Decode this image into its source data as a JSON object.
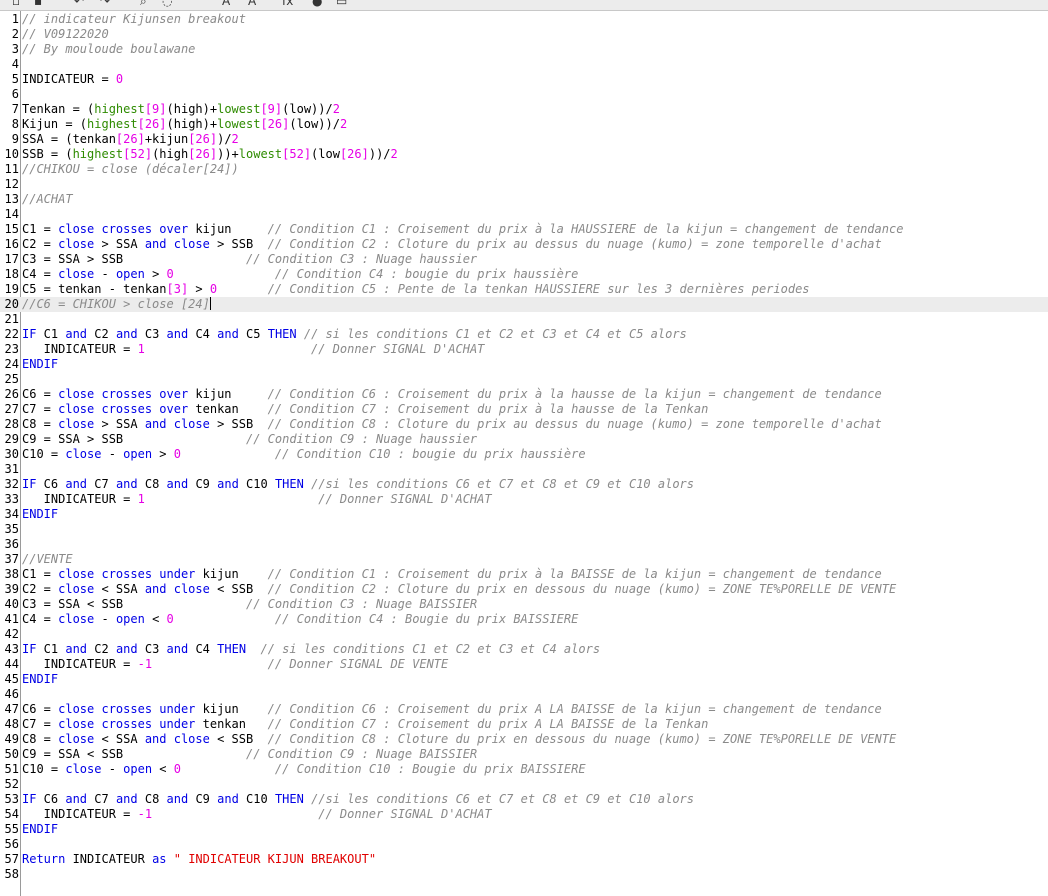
{
  "toolbar": {
    "buttons": [
      {
        "name": "new-file-icon",
        "glyph": "▫"
      },
      {
        "name": "open-folder-icon",
        "glyph": "▪"
      },
      {
        "name": "undo-icon",
        "glyph": "↶"
      },
      {
        "name": "redo-icon",
        "glyph": "↷"
      },
      {
        "name": "search-icon",
        "glyph": "⌕"
      },
      {
        "name": "comment-icon",
        "glyph": "◌"
      },
      {
        "name": "font-increase-icon",
        "glyph": "A"
      },
      {
        "name": "font-decrease-icon",
        "glyph": "A"
      },
      {
        "name": "function-icon",
        "glyph": "fx"
      },
      {
        "name": "help-icon",
        "glyph": "●"
      },
      {
        "name": "print-icon",
        "glyph": "▭"
      }
    ]
  },
  "editor": {
    "current_line": 20,
    "colors": {
      "keyword": "#0000e6",
      "number": "#e600e6",
      "function": "#2e8b00",
      "comment": "#8a8a8a",
      "string": "#e00000"
    },
    "lines": [
      {
        "n": "1",
        "t": [
          [
            "c",
            "// indicateur Kijunsen breakout"
          ]
        ]
      },
      {
        "n": "2",
        "t": [
          [
            "c",
            "// V09122020"
          ]
        ]
      },
      {
        "n": "3",
        "t": [
          [
            "c",
            "// By mouloude boulawane"
          ]
        ]
      },
      {
        "n": "4",
        "t": []
      },
      {
        "n": "5",
        "t": [
          [
            "p",
            "INDICATEUR = "
          ],
          [
            "n",
            "0"
          ]
        ]
      },
      {
        "n": "6",
        "t": []
      },
      {
        "n": "7",
        "t": [
          [
            "p",
            "Tenkan = ("
          ],
          [
            "f",
            "highest"
          ],
          [
            "n",
            "[9]"
          ],
          [
            "p",
            "(high)+"
          ],
          [
            "f",
            "lowest"
          ],
          [
            "n",
            "[9]"
          ],
          [
            "p",
            "(low))/"
          ],
          [
            "n",
            "2"
          ]
        ]
      },
      {
        "n": "8",
        "t": [
          [
            "p",
            "Kijun = ("
          ],
          [
            "f",
            "highest"
          ],
          [
            "n",
            "[26]"
          ],
          [
            "p",
            "(high)+"
          ],
          [
            "f",
            "lowest"
          ],
          [
            "n",
            "[26]"
          ],
          [
            "p",
            "(low))/"
          ],
          [
            "n",
            "2"
          ]
        ]
      },
      {
        "n": "9",
        "t": [
          [
            "p",
            "SSA = (tenkan"
          ],
          [
            "n",
            "[26]"
          ],
          [
            "p",
            "+kijun"
          ],
          [
            "n",
            "[26]"
          ],
          [
            "p",
            ")/"
          ],
          [
            "n",
            "2"
          ]
        ]
      },
      {
        "n": "10",
        "t": [
          [
            "p",
            "SSB = ("
          ],
          [
            "f",
            "highest"
          ],
          [
            "n",
            "[52]"
          ],
          [
            "p",
            "(high"
          ],
          [
            "n",
            "[26]"
          ],
          [
            "p",
            "))+"
          ],
          [
            "f",
            "lowest"
          ],
          [
            "n",
            "[52]"
          ],
          [
            "p",
            "(low"
          ],
          [
            "n",
            "[26]"
          ],
          [
            "p",
            "))/"
          ],
          [
            "n",
            "2"
          ]
        ]
      },
      {
        "n": "11",
        "t": [
          [
            "c",
            "//CHIKOU = close (décaler[24])"
          ]
        ]
      },
      {
        "n": "12",
        "t": []
      },
      {
        "n": "13",
        "t": [
          [
            "c",
            "//ACHAT"
          ]
        ]
      },
      {
        "n": "14",
        "t": []
      },
      {
        "n": "15",
        "t": [
          [
            "p",
            "C1 = "
          ],
          [
            "k",
            "close crosses over"
          ],
          [
            "p",
            " kijun     "
          ],
          [
            "c",
            "// Condition C1 : Croisement du prix à la HAUSSIERE de la kijun = changement de tendance"
          ]
        ]
      },
      {
        "n": "16",
        "t": [
          [
            "p",
            "C2 = "
          ],
          [
            "k",
            "close"
          ],
          [
            "p",
            " > SSA "
          ],
          [
            "k",
            "and close"
          ],
          [
            "p",
            " > SSB  "
          ],
          [
            "c",
            "// Condition C2 : Cloture du prix au dessus du nuage (kumo) = zone temporelle d'achat"
          ]
        ]
      },
      {
        "n": "17",
        "t": [
          [
            "p",
            "C3 = SSA > SSB                 "
          ],
          [
            "c",
            "// Condition C3 : Nuage haussier"
          ]
        ]
      },
      {
        "n": "18",
        "t": [
          [
            "p",
            "C4 = "
          ],
          [
            "k",
            "close"
          ],
          [
            "p",
            " - "
          ],
          [
            "k",
            "open"
          ],
          [
            "p",
            " > "
          ],
          [
            "n",
            "0"
          ],
          [
            "p",
            "              "
          ],
          [
            "c",
            "// Condition C4 : bougie du prix haussière"
          ]
        ]
      },
      {
        "n": "19",
        "t": [
          [
            "p",
            "C5 = tenkan - tenkan"
          ],
          [
            "n",
            "[3]"
          ],
          [
            "p",
            " > "
          ],
          [
            "n",
            "0"
          ],
          [
            "p",
            "       "
          ],
          [
            "c",
            "// Condition C5 : Pente de la tenkan HAUSSIERE sur les 3 dernières periodes"
          ]
        ]
      },
      {
        "n": "20",
        "t": [
          [
            "c",
            "//C6 = CHIKOU > close [24]"
          ]
        ]
      },
      {
        "n": "21",
        "t": []
      },
      {
        "n": "22",
        "t": [
          [
            "k",
            "IF"
          ],
          [
            "p",
            " C1 "
          ],
          [
            "k",
            "and"
          ],
          [
            "p",
            " C2 "
          ],
          [
            "k",
            "and"
          ],
          [
            "p",
            " C3 "
          ],
          [
            "k",
            "and"
          ],
          [
            "p",
            " C4 "
          ],
          [
            "k",
            "and"
          ],
          [
            "p",
            " C5 "
          ],
          [
            "k",
            "THEN"
          ],
          [
            "p",
            " "
          ],
          [
            "c",
            "// si les conditions C1 et C2 et C3 et C4 et C5 alors"
          ]
        ]
      },
      {
        "n": "23",
        "t": [
          [
            "p",
            "   INDICATEUR = "
          ],
          [
            "n",
            "1"
          ],
          [
            "p",
            "                       "
          ],
          [
            "c",
            "// Donner SIGNAL D'ACHAT"
          ]
        ]
      },
      {
        "n": "24",
        "t": [
          [
            "k",
            "ENDIF"
          ]
        ]
      },
      {
        "n": "25",
        "t": []
      },
      {
        "n": "26",
        "t": [
          [
            "p",
            "C6 = "
          ],
          [
            "k",
            "close crosses over"
          ],
          [
            "p",
            " kijun     "
          ],
          [
            "c",
            "// Condition C6 : Croisement du prix à la hausse de la kijun = changement de tendance"
          ]
        ]
      },
      {
        "n": "27",
        "t": [
          [
            "p",
            "C7 = "
          ],
          [
            "k",
            "close crosses over"
          ],
          [
            "p",
            " tenkan    "
          ],
          [
            "c",
            "// Condition C7 : Croisement du prix à la hausse de la Tenkan"
          ]
        ]
      },
      {
        "n": "28",
        "t": [
          [
            "p",
            "C8 = "
          ],
          [
            "k",
            "close"
          ],
          [
            "p",
            " > SSA "
          ],
          [
            "k",
            "and close"
          ],
          [
            "p",
            " > SSB  "
          ],
          [
            "c",
            "// Condition C8 : Cloture du prix au dessus du nuage (kumo) = zone temporelle d'achat"
          ]
        ]
      },
      {
        "n": "29",
        "t": [
          [
            "p",
            "C9 = SSA > SSB                 "
          ],
          [
            "c",
            "// Condition C9 : Nuage haussier"
          ]
        ]
      },
      {
        "n": "30",
        "t": [
          [
            "p",
            "C10 = "
          ],
          [
            "k",
            "close"
          ],
          [
            "p",
            " - "
          ],
          [
            "k",
            "open"
          ],
          [
            "p",
            " > "
          ],
          [
            "n",
            "0"
          ],
          [
            "p",
            "             "
          ],
          [
            "c",
            "// Condition C10 : bougie du prix haussière"
          ]
        ]
      },
      {
        "n": "31",
        "t": []
      },
      {
        "n": "32",
        "t": [
          [
            "k",
            "IF"
          ],
          [
            "p",
            " C6 "
          ],
          [
            "k",
            "and"
          ],
          [
            "p",
            " C7 "
          ],
          [
            "k",
            "and"
          ],
          [
            "p",
            " C8 "
          ],
          [
            "k",
            "and"
          ],
          [
            "p",
            " C9 "
          ],
          [
            "k",
            "and"
          ],
          [
            "p",
            " C10 "
          ],
          [
            "k",
            "THEN"
          ],
          [
            "p",
            " "
          ],
          [
            "c",
            "//si les conditions C6 et C7 et C8 et C9 et C10 alors"
          ]
        ]
      },
      {
        "n": "33",
        "t": [
          [
            "p",
            "   INDICATEUR = "
          ],
          [
            "n",
            "1"
          ],
          [
            "p",
            "                        "
          ],
          [
            "c",
            "// Donner SIGNAL D'ACHAT"
          ]
        ]
      },
      {
        "n": "34",
        "t": [
          [
            "k",
            "ENDIF"
          ]
        ]
      },
      {
        "n": "35",
        "t": []
      },
      {
        "n": "36",
        "t": []
      },
      {
        "n": "37",
        "t": [
          [
            "c",
            "//VENTE"
          ]
        ]
      },
      {
        "n": "38",
        "t": [
          [
            "p",
            "C1 = "
          ],
          [
            "k",
            "close crosses under"
          ],
          [
            "p",
            " kijun    "
          ],
          [
            "c",
            "// Condition C1 : Croisement du prix à la BAISSE de la kijun = changement de tendance"
          ]
        ]
      },
      {
        "n": "39",
        "t": [
          [
            "p",
            "C2 = "
          ],
          [
            "k",
            "close"
          ],
          [
            "p",
            " < SSA "
          ],
          [
            "k",
            "and close"
          ],
          [
            "p",
            " < SSB  "
          ],
          [
            "c",
            "// Condition C2 : Cloture du prix en dessous du nuage (kumo) = ZONE TE%PORELLE DE VENTE"
          ]
        ]
      },
      {
        "n": "40",
        "t": [
          [
            "p",
            "C3 = SSA < SSB                 "
          ],
          [
            "c",
            "// Condition C3 : Nuage BAISSIER"
          ]
        ]
      },
      {
        "n": "41",
        "t": [
          [
            "p",
            "C4 = "
          ],
          [
            "k",
            "close"
          ],
          [
            "p",
            " - "
          ],
          [
            "k",
            "open"
          ],
          [
            "p",
            " < "
          ],
          [
            "n",
            "0"
          ],
          [
            "p",
            "              "
          ],
          [
            "c",
            "// Condition C4 : Bougie du prix BAISSIERE"
          ]
        ]
      },
      {
        "n": "42",
        "t": []
      },
      {
        "n": "43",
        "t": [
          [
            "k",
            "IF"
          ],
          [
            "p",
            " C1 "
          ],
          [
            "k",
            "and"
          ],
          [
            "p",
            " C2 "
          ],
          [
            "k",
            "and"
          ],
          [
            "p",
            " C3 "
          ],
          [
            "k",
            "and"
          ],
          [
            "p",
            " C4 "
          ],
          [
            "k",
            "THEN"
          ],
          [
            "p",
            "  "
          ],
          [
            "c",
            "// si les conditions C1 et C2 et C3 et C4 alors"
          ]
        ]
      },
      {
        "n": "44",
        "t": [
          [
            "p",
            "   INDICATEUR = "
          ],
          [
            "n",
            "-1"
          ],
          [
            "p",
            "                "
          ],
          [
            "c",
            "// Donner SIGNAL DE VENTE"
          ]
        ]
      },
      {
        "n": "45",
        "t": [
          [
            "k",
            "ENDIF"
          ]
        ]
      },
      {
        "n": "46",
        "t": []
      },
      {
        "n": "47",
        "t": [
          [
            "p",
            "C6 = "
          ],
          [
            "k",
            "close crosses under"
          ],
          [
            "p",
            " kijun    "
          ],
          [
            "c",
            "// Condition C6 : Croisement du prix A LA BAISSE de la kijun = changement de tendance"
          ]
        ]
      },
      {
        "n": "48",
        "t": [
          [
            "p",
            "C7 = "
          ],
          [
            "k",
            "close crosses under"
          ],
          [
            "p",
            " tenkan   "
          ],
          [
            "c",
            "// Condition C7 : Croisement du prix A LA BAISSE de la Tenkan"
          ]
        ]
      },
      {
        "n": "49",
        "t": [
          [
            "p",
            "C8 = "
          ],
          [
            "k",
            "close"
          ],
          [
            "p",
            " < SSA "
          ],
          [
            "k",
            "and close"
          ],
          [
            "p",
            " < SSB  "
          ],
          [
            "c",
            "// Condition C8 : Cloture du prix en dessous du nuage (kumo) = ZONE TE%PORELLE DE VENTE"
          ]
        ]
      },
      {
        "n": "50",
        "t": [
          [
            "p",
            "C9 = SSA < SSB                 "
          ],
          [
            "c",
            "// Condition C9 : Nuage BAISSIER"
          ]
        ]
      },
      {
        "n": "51",
        "t": [
          [
            "p",
            "C10 = "
          ],
          [
            "k",
            "close"
          ],
          [
            "p",
            " - "
          ],
          [
            "k",
            "open"
          ],
          [
            "p",
            " < "
          ],
          [
            "n",
            "0"
          ],
          [
            "p",
            "             "
          ],
          [
            "c",
            "// Condition C10 : Bougie du prix BAISSIERE"
          ]
        ]
      },
      {
        "n": "52",
        "t": []
      },
      {
        "n": "53",
        "t": [
          [
            "k",
            "IF"
          ],
          [
            "p",
            " C6 "
          ],
          [
            "k",
            "and"
          ],
          [
            "p",
            " C7 "
          ],
          [
            "k",
            "and"
          ],
          [
            "p",
            " C8 "
          ],
          [
            "k",
            "and"
          ],
          [
            "p",
            " C9 "
          ],
          [
            "k",
            "and"
          ],
          [
            "p",
            " C10 "
          ],
          [
            "k",
            "THEN"
          ],
          [
            "p",
            " "
          ],
          [
            "c",
            "//si les conditions C6 et C7 et C8 et C9 et C10 alors"
          ]
        ]
      },
      {
        "n": "54",
        "t": [
          [
            "p",
            "   INDICATEUR = "
          ],
          [
            "n",
            "-1"
          ],
          [
            "p",
            "                       "
          ],
          [
            "c",
            "// Donner SIGNAL D'ACHAT"
          ]
        ]
      },
      {
        "n": "55",
        "t": [
          [
            "k",
            "ENDIF"
          ]
        ]
      },
      {
        "n": "56",
        "t": []
      },
      {
        "n": "57",
        "t": [
          [
            "k",
            "Return"
          ],
          [
            "p",
            " INDICATEUR "
          ],
          [
            "k",
            "as"
          ],
          [
            "p",
            " "
          ],
          [
            "s",
            "\" INDICATEUR KIJUN BREAKOUT\""
          ]
        ]
      },
      {
        "n": "58",
        "t": []
      }
    ]
  }
}
